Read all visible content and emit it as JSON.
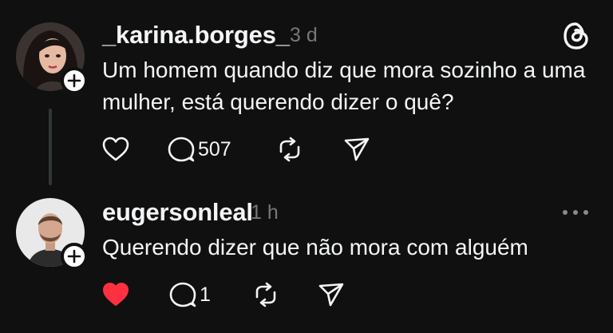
{
  "posts": [
    {
      "username": "_karina.borges_",
      "time": "3 d",
      "text": "Um homem quando diz que mora sozinho a uma mulher, está querendo dizer o quê?",
      "reply_count": "507",
      "liked": false,
      "avatar_icon": "illustrated-woman-avatar"
    },
    {
      "username": "eugersonleal",
      "time": "1 h",
      "text": "Querendo dizer que não mora com alguém",
      "reply_count": "1",
      "liked": true,
      "avatar_icon": "man-photo-avatar"
    }
  ],
  "colors": {
    "background": "#101010",
    "text": "#f3f5f7",
    "muted": "#777777",
    "like_red": "#ff3040"
  },
  "icons": [
    "threads-logo-icon",
    "more-options-icon",
    "heart-icon",
    "reply-icon",
    "repost-icon",
    "share-icon",
    "plus-icon"
  ]
}
